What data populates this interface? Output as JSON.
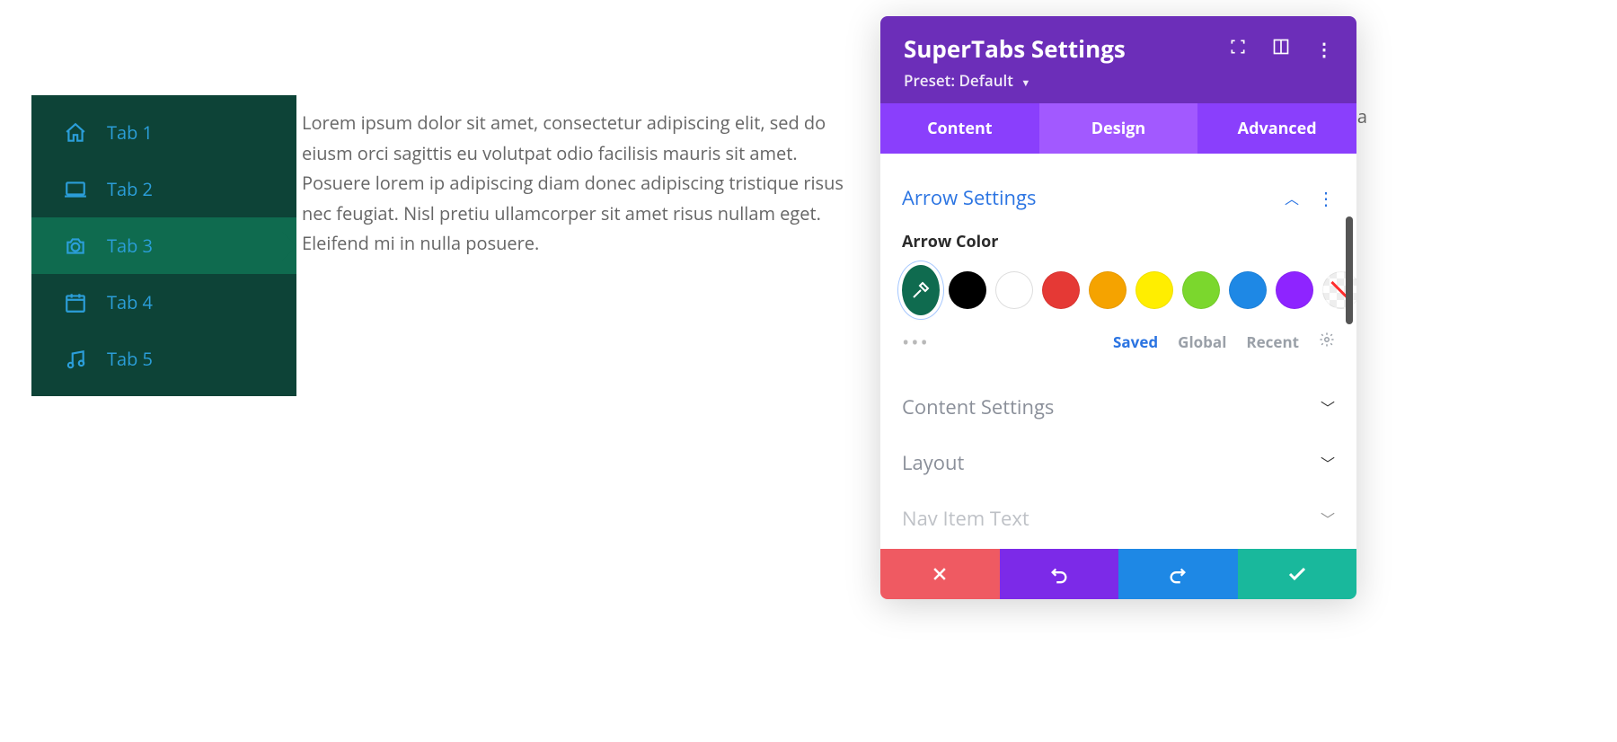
{
  "tabs": {
    "items": [
      {
        "label": "Tab 1",
        "icon": "home-icon"
      },
      {
        "label": "Tab 2",
        "icon": "laptop-icon"
      },
      {
        "label": "Tab 3",
        "icon": "camera-icon"
      },
      {
        "label": "Tab 4",
        "icon": "calendar-icon"
      },
      {
        "label": "Tab 5",
        "icon": "music-icon"
      }
    ],
    "active_index": 2,
    "content": "Lorem ipsum dolor sit amet, consectetur adipiscing elit, sed do eiusm orci sagittis eu volutpat odio facilisis mauris sit amet. Posuere lorem ip adipiscing diam donec adipiscing tristique risus nec feugiat. Nisl pretiu ullamcorper sit amet risus nullam eget. Eleifend mi in nulla posuere."
  },
  "overflow_letter": "a",
  "panel": {
    "title": "SuperTabs Settings",
    "preset_label": "Preset: Default",
    "tabs": [
      {
        "label": "Content"
      },
      {
        "label": "Design"
      },
      {
        "label": "Advanced"
      }
    ],
    "active_tab_index": 1,
    "arrow_section": {
      "title": "Arrow Settings",
      "field_label": "Arrow Color",
      "selected_color": "#0f6b4f",
      "swatches": [
        "#000000",
        "#ffffff",
        "#e53935",
        "#f5a300",
        "#ffee00",
        "#7bd72d",
        "#1e88e5",
        "#8e24ff"
      ],
      "palette_links": {
        "saved": "Saved",
        "global": "Global",
        "recent": "Recent"
      }
    },
    "collapsed_sections": [
      {
        "title": "Content Settings"
      },
      {
        "title": "Layout"
      },
      {
        "title": "Nav Item Text"
      }
    ]
  }
}
